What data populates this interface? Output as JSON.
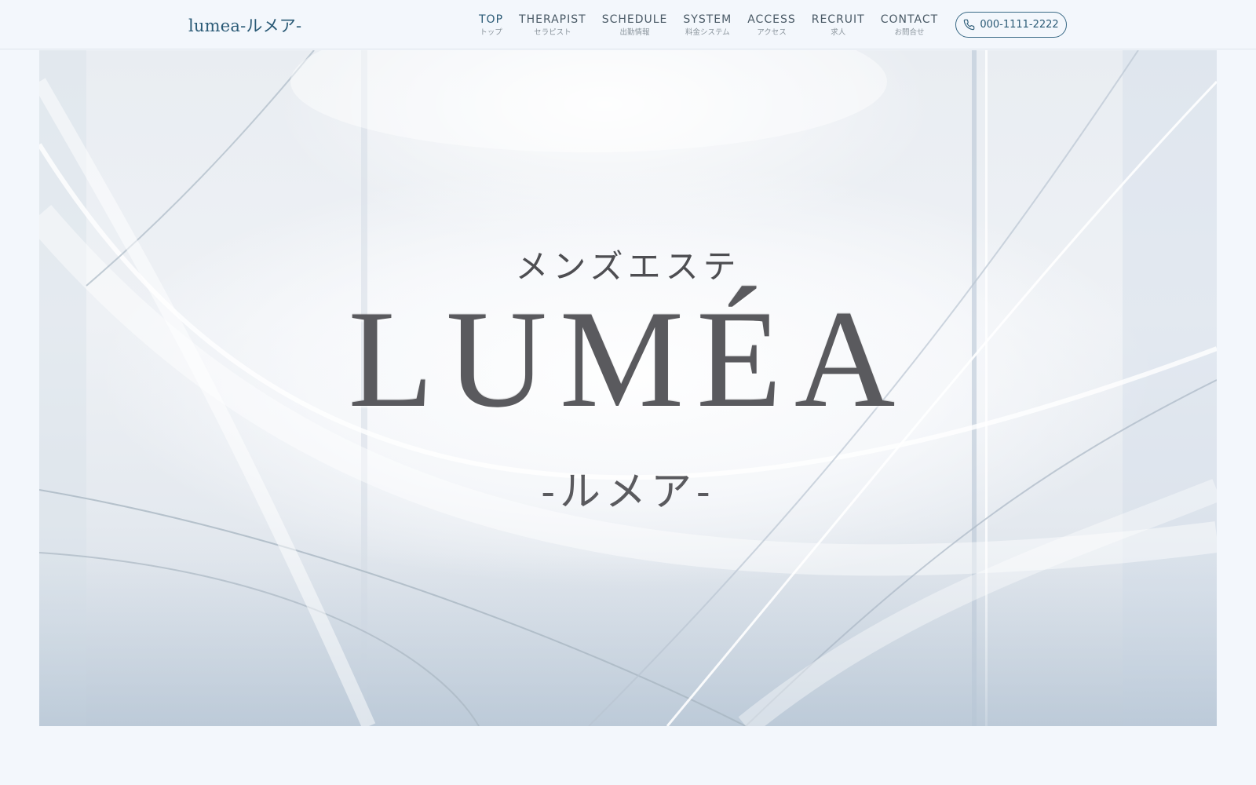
{
  "header": {
    "logo": "lumea-ルメア-",
    "nav": [
      {
        "en": "TOP",
        "ja": "トップ"
      },
      {
        "en": "THERAPIST",
        "ja": "セラピスト"
      },
      {
        "en": "SCHEDULE",
        "ja": "出勤情報"
      },
      {
        "en": "SYSTEM",
        "ja": "料金システム"
      },
      {
        "en": "ACCESS",
        "ja": "アクセス"
      },
      {
        "en": "RECRUIT",
        "ja": "求人"
      },
      {
        "en": "CONTACT",
        "ja": "お問合せ"
      }
    ],
    "active_nav": "TOP",
    "phone": "000-1111-2222"
  },
  "hero": {
    "subtitle": "メンズエステ",
    "title": "LUMÉA",
    "kana": "-ルメア-"
  },
  "colors": {
    "accent": "#2a5a76",
    "background": "#f3f7fc"
  },
  "icons": {
    "phone": "phone-icon"
  }
}
